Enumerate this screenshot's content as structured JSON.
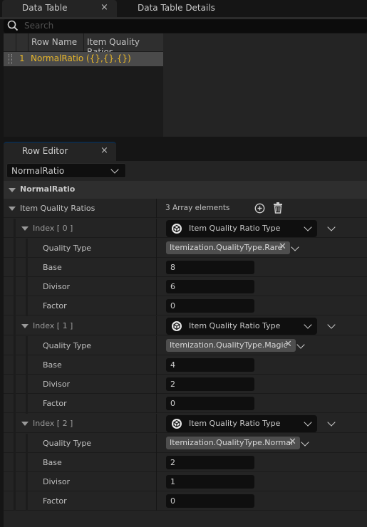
{
  "tabs": {
    "data_table": {
      "label": "Data Table",
      "close": "×"
    },
    "data_table_details": {
      "label": "Data Table Details"
    }
  },
  "search": {
    "placeholder": "Search",
    "icon": "search-icon"
  },
  "table": {
    "columns": [
      "Row Name",
      "Item Quality Ratios"
    ],
    "rows": [
      {
        "index": "1",
        "row_name": "NormalRatio",
        "item_quality_ratios": "({},{},{})"
      }
    ],
    "highlight_color": "#e7b62a"
  },
  "row_editor": {
    "tab_label": "Row Editor",
    "close": "×",
    "selected_row": "NormalRatio",
    "category": "NormalRatio",
    "array_property": {
      "label": "Item Quality Ratios",
      "count_text": "3 Array elements",
      "add_icon": "add-circle-icon",
      "delete_icon": "trash-icon"
    },
    "elements": [
      {
        "index_label": "Index [ 0 ]",
        "struct_type": "Item Quality Ratio Type",
        "fields": {
          "quality_type_label": "Quality Type",
          "quality_type": "Itemization.QualityType.Rare",
          "base_label": "Base",
          "base": "8",
          "divisor_label": "Divisor",
          "divisor": "6",
          "factor_label": "Factor",
          "factor": "0"
        }
      },
      {
        "index_label": "Index [ 1 ]",
        "struct_type": "Item Quality Ratio Type",
        "fields": {
          "quality_type_label": "Quality Type",
          "quality_type": "Itemization.QualityType.Magic",
          "base_label": "Base",
          "base": "4",
          "divisor_label": "Divisor",
          "divisor": "2",
          "factor_label": "Factor",
          "factor": "0"
        }
      },
      {
        "index_label": "Index [ 2 ]",
        "struct_type": "Item Quality Ratio Type",
        "fields": {
          "quality_type_label": "Quality Type",
          "quality_type": "Itemization.QualityType.Normal",
          "base_label": "Base",
          "base": "2",
          "divisor_label": "Divisor",
          "divisor": "1",
          "factor_label": "Factor",
          "factor": "0"
        }
      }
    ]
  }
}
